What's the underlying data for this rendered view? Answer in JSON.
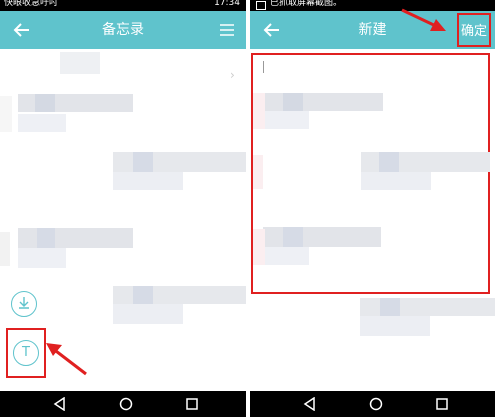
{
  "left_screen": {
    "status_bar": {
      "left_text": "快眼收急吁吋",
      "right_text": "17:34"
    },
    "app_bar": {
      "title": "备忘录",
      "back_icon": "arrow-left-icon",
      "menu_icon": "hamburger-menu-icon"
    },
    "fab_icons": [
      "download-icon",
      "text-T-icon"
    ],
    "fab_text_glyph": "T"
  },
  "right_screen": {
    "status_bar": {
      "left_text": "已抓取屏幕截图。"
    },
    "app_bar": {
      "title": "新建",
      "back_icon": "arrow-left-icon",
      "confirm_label": "确定"
    }
  },
  "nav_bar": {
    "icons": [
      "nav-back-icon",
      "nav-home-icon",
      "nav-recent-apps-icon"
    ]
  },
  "colors": {
    "accent": "#5fc3cc",
    "annotation_red": "#e02020",
    "nav_bar": "#000000"
  }
}
